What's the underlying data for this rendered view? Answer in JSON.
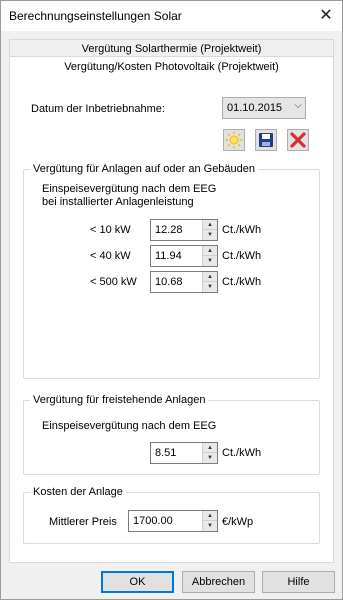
{
  "window": {
    "title": "Berechnungseinstellungen Solar",
    "close_glyph": "✕"
  },
  "tabs": [
    {
      "label": "Vergütung Solarthermie (Projektweit)"
    },
    {
      "label": "Vergütung/Kosten Photovoltaik (Projektweit)"
    }
  ],
  "commissioning": {
    "label": "Datum der Inbetriebnahme:",
    "date_value": "01.10.2015",
    "icons": [
      "sun-icon",
      "save-icon",
      "delete-icon"
    ]
  },
  "buildings_group": {
    "legend": "Vergütung für Anlagen auf oder an Gebäuden",
    "description_line1": "Einspeisevergütung nach dem EEG",
    "description_line2": "bei installierter Anlagenleistung",
    "rows": [
      {
        "label": "< 10 kW",
        "value": "12.28",
        "unit": "Ct./kWh"
      },
      {
        "label": "< 40 kW",
        "value": "11.94",
        "unit": "Ct./kWh"
      },
      {
        "label": "< 500 kW",
        "value": "10.68",
        "unit": "Ct./kWh"
      }
    ]
  },
  "freestanding_group": {
    "legend": "Vergütung für freistehende Anlagen",
    "description": "Einspeisevergütung nach dem EEG",
    "value": "8.51",
    "unit": "Ct./kWh"
  },
  "costs_group": {
    "legend": "Kosten der Anlage",
    "label": "Mittlerer Preis",
    "value": "1700.00",
    "unit": "€/kWp"
  },
  "buttons": {
    "ok": "OK",
    "cancel": "Abbrechen",
    "help": "Hilfe"
  },
  "colors": {
    "accent": "#0078d7",
    "delete": "#d32f2f",
    "sun": "#f5b800",
    "save": "#1f3d8a"
  }
}
